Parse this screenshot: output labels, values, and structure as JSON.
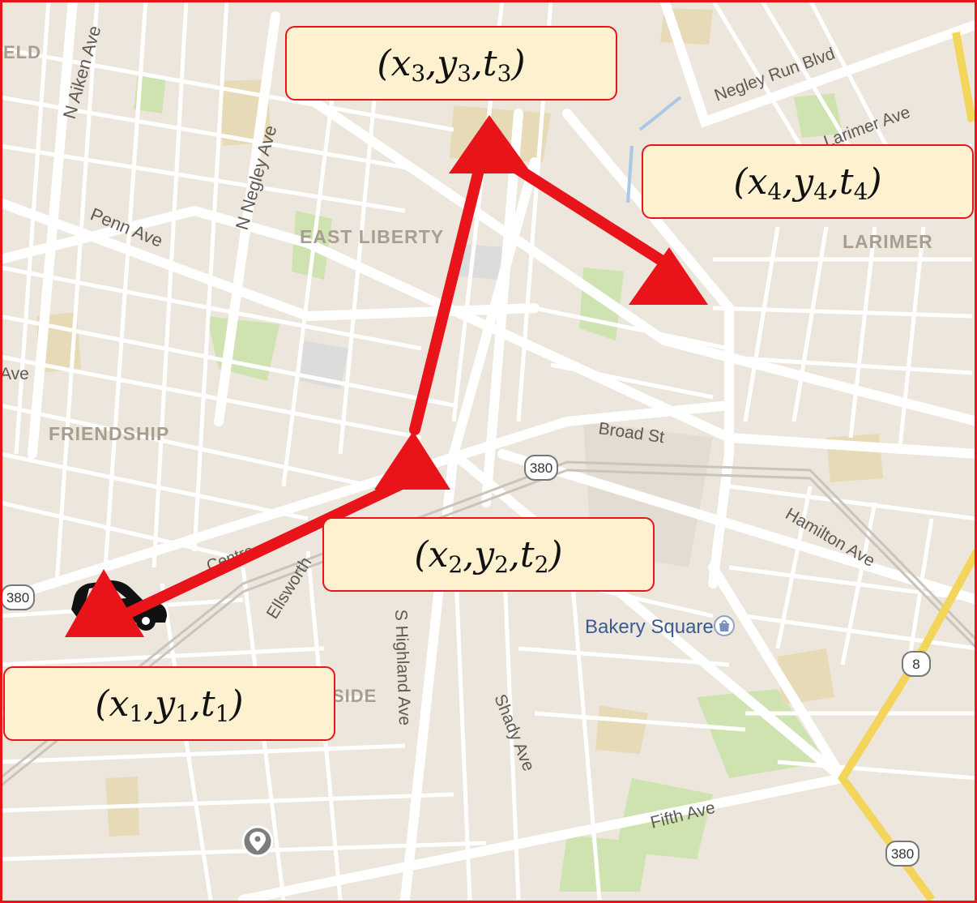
{
  "map": {
    "streets": {
      "aiken": "N Aiken Ave",
      "negley": "N Negley Ave",
      "penn": "Penn Ave",
      "negley_run": "Negley Run Blvd",
      "larimer_ave": "Larimer Ave",
      "broad": "Broad St",
      "hamilton": "Hamilton Ave",
      "ellsworth": "Ellsworth",
      "highland": "S Highland Ave",
      "shady": "Shady Ave",
      "fifth": "Fifth Ave"
    },
    "fragments": {
      "top_left": "ELD",
      "left_ave": "Ave",
      "side": "SIDE",
      "center_street": "Centre"
    },
    "neighborhoods": {
      "east_liberty": "EAST LIBERTY",
      "larimer": "LARIMER",
      "friendship": "FRIENDSHIP"
    },
    "poi": {
      "bakery_square": "Bakery Square"
    },
    "shields": {
      "center": "380",
      "left": "380",
      "bottom_right": "380",
      "route8": "8"
    }
  },
  "trajectory": {
    "color": "#e8141a",
    "points": [
      {
        "label": "(x1, y1, t1)",
        "var_x": "x",
        "var_y": "y",
        "var_t": "t",
        "sub": "1"
      },
      {
        "label": "(x2, y2, t2)",
        "var_x": "x",
        "var_y": "y",
        "var_t": "t",
        "sub": "2"
      },
      {
        "label": "(x3, y3, t3)",
        "var_x": "x",
        "var_y": "y",
        "var_t": "t",
        "sub": "3"
      },
      {
        "label": "(x4, y4, t4)",
        "var_x": "x",
        "var_y": "y",
        "var_t": "t",
        "sub": "4"
      }
    ]
  },
  "icons": {
    "vehicle": "car-icon",
    "marker": "map-pin-icon",
    "bakery": "shopping-bag-icon"
  },
  "colors": {
    "land": "#ece6dc",
    "road": "#ffffff",
    "park": "#cfe3b0",
    "highway": "#f4d55c",
    "frame": "#e8141a"
  }
}
